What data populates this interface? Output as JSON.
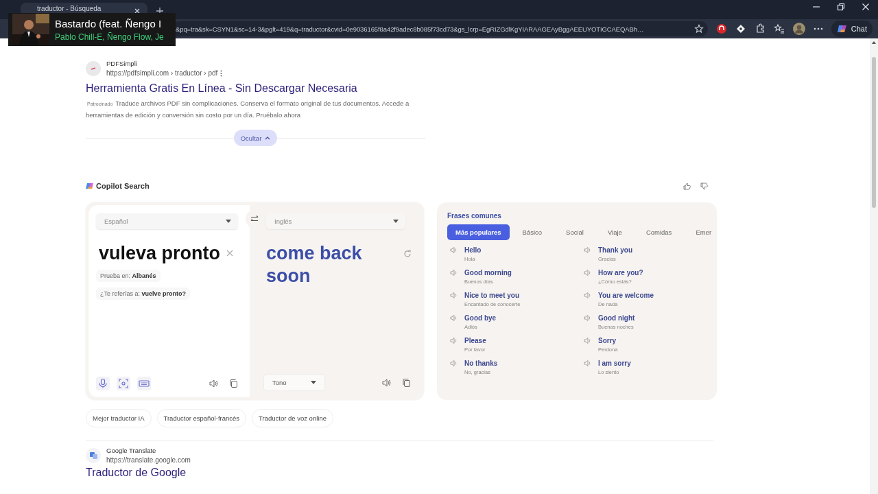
{
  "browser": {
    "tab_title": "traductor - Búsqueda",
    "address": "&pq=tra&sk=CSYN1&sc=14-3&pglt=419&q=traductor&cvid=0e9036165f8a42f9adec8b085f73cd73&gs_lcrp=EgRIZGdlKgYIARAAGEAyBggAEEUYOTIGCAEQABh…",
    "chat_label": "Chat"
  },
  "media_overlay": {
    "title": "Bastardo (feat. Ñengo I",
    "artist": "Pablo Chill-E, Ñengo Flow, Je"
  },
  "ad": {
    "site": "PDFSimpli",
    "url": "https://pdfsimpli.com › traductor › pdf",
    "title": "Herramienta Gratis En Línea - Sin Descargar Necesaria",
    "badge": "Patrocinado",
    "description": "Traduce archivos PDF sin complicaciones. Conserva el formato original de tus documentos. Accede a herramientas de edición y conversión sin costo por un día. Pruébalo ahora",
    "hide_button": "Ocultar"
  },
  "copilot": {
    "title": "Copilot Search",
    "source_language": "Español",
    "target_language": "Inglés",
    "input": "vuleva pronto",
    "output": "come back soon",
    "try_in": "Prueba en: **Albanés**",
    "did_you_mean": "¿Te referías a: **vuelve pronto?**",
    "tone": "Tono",
    "phrases": {
      "title": "Frases comunes",
      "tabs": [
        {
          "label": "Más populares",
          "selected": true
        },
        {
          "label": "Básico",
          "selected": false
        },
        {
          "label": "Social",
          "selected": false
        },
        {
          "label": "Viaje",
          "selected": false
        },
        {
          "label": "Comidas",
          "selected": false
        },
        {
          "label": "Emer",
          "selected": false
        }
      ],
      "items": [
        {
          "phrase": "Hello",
          "translation": "Hola"
        },
        {
          "phrase": "Thank you",
          "translation": "Gracias"
        },
        {
          "phrase": "Good morning",
          "translation": "Buenos días"
        },
        {
          "phrase": "How are you?",
          "translation": "¿Cómo estás?"
        },
        {
          "phrase": "Nice to meet you",
          "translation": "Encantado de conocerte"
        },
        {
          "phrase": "You are welcome",
          "translation": "De nada"
        },
        {
          "phrase": "Good bye",
          "translation": "Adiós"
        },
        {
          "phrase": "Good night",
          "translation": "Buenas noches"
        },
        {
          "phrase": "Please",
          "translation": "Por favor"
        },
        {
          "phrase": "Sorry",
          "translation": "Perdona"
        },
        {
          "phrase": "No thanks",
          "translation": "No, gracias"
        },
        {
          "phrase": "I am sorry",
          "translation": "Lo siento"
        }
      ]
    }
  },
  "related": [
    "Mejor traductor IA",
    "Traductor español-francés",
    "Traductor de voz online"
  ],
  "result": {
    "site": "Google Translate",
    "url": "https://translate.google.com",
    "title": "Traductor de Google"
  }
}
